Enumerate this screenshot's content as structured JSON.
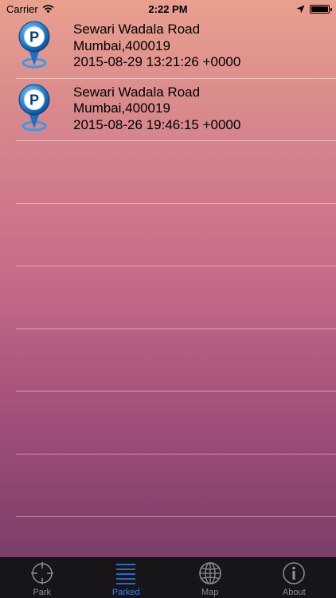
{
  "status_bar": {
    "carrier": "Carrier",
    "time": "2:22 PM"
  },
  "parked_list": [
    {
      "street": "Sewari Wadala Road",
      "city": "Mumbai,400019",
      "timestamp": "2015-08-29 13:21:26 +0000"
    },
    {
      "street": "Sewari Wadala Road",
      "city": "Mumbai,400019",
      "timestamp": "2015-08-26 19:46:15 +0000"
    }
  ],
  "tabbar": {
    "tabs": [
      {
        "label": "Park",
        "icon": "crosshair-icon"
      },
      {
        "label": "Parked",
        "icon": "list-icon",
        "active": true
      },
      {
        "label": "Map",
        "icon": "globe-icon"
      },
      {
        "label": "About",
        "icon": "info-icon"
      }
    ]
  },
  "colors": {
    "accent": "#2f86ff",
    "inactive_tab": "#8e8e93"
  }
}
